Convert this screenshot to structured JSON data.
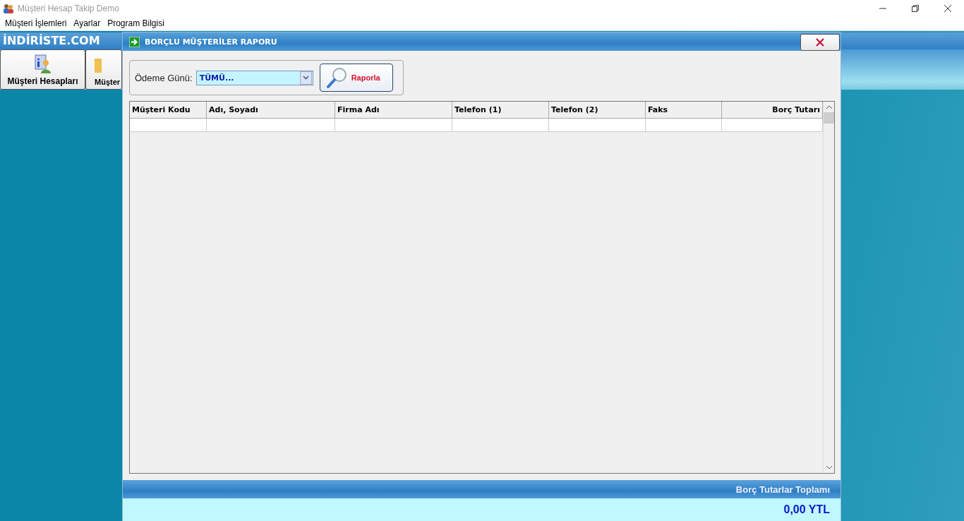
{
  "window": {
    "title": "Müşteri Hesap Takip Demo"
  },
  "menu": [
    "Müşteri İşlemleri",
    "Ayarlar",
    "Program Bilgisi"
  ],
  "brand": "İNDİRİSTE.COM",
  "toolbar": [
    {
      "label": "Müşteri Hesapları",
      "kind": "accounts"
    },
    {
      "label": "Müşter",
      "kind": "folder"
    }
  ],
  "dialog": {
    "title": "BORÇLU MÜŞTERİLER RAPORU",
    "filter": {
      "label": "Ödeme Günü:",
      "value": "TÜMÜ..."
    },
    "report_button": "Raporla",
    "table": {
      "columns": [
        {
          "label": "Müşteri Kodu"
        },
        {
          "label": "Adı, Soyadı"
        },
        {
          "label": "Firma Adı"
        },
        {
          "label": "Telefon (1)"
        },
        {
          "label": "Telefon (2)"
        },
        {
          "label": "Faks"
        },
        {
          "label": "Borç Tutarı"
        }
      ]
    },
    "footer": {
      "label": "Borç Tutarlar Toplamı",
      "total": "0,00 YTL"
    }
  }
}
